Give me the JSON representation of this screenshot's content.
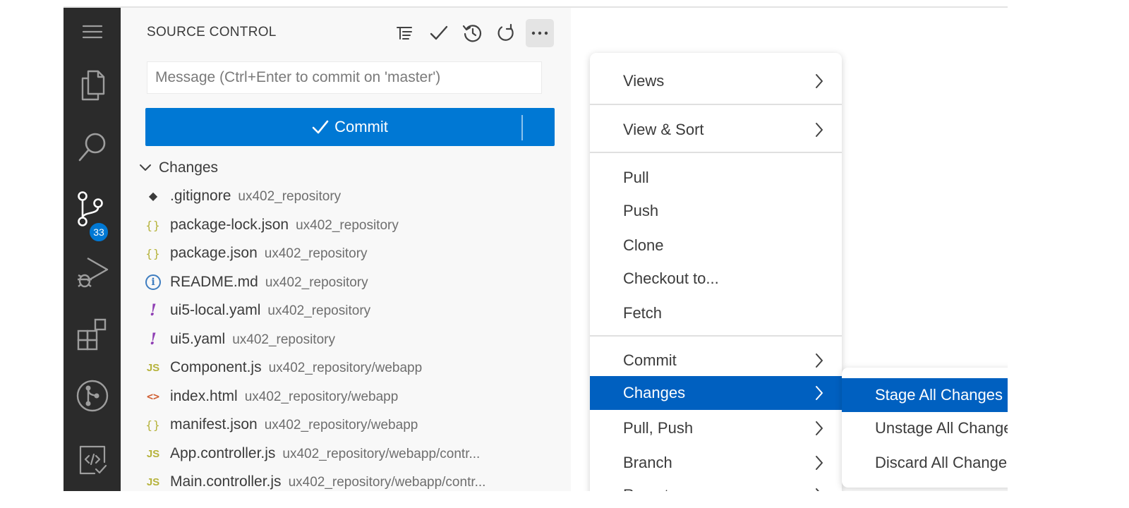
{
  "activity_bar": {
    "items": [
      {
        "name": "menu",
        "icon": "hamburger-menu-icon"
      },
      {
        "name": "explorer",
        "icon": "files-icon"
      },
      {
        "name": "search",
        "icon": "search-icon"
      },
      {
        "name": "source-control",
        "icon": "source-control-icon",
        "badge": "33"
      },
      {
        "name": "run-debug",
        "icon": "run-debug-icon"
      },
      {
        "name": "extensions",
        "icon": "extensions-icon"
      },
      {
        "name": "git-graph",
        "icon": "git-graph-icon"
      },
      {
        "name": "sap-tools",
        "icon": "code-check-icon"
      }
    ]
  },
  "sidebar": {
    "title": "SOURCE CONTROL",
    "toolbar": [
      "tree-view-icon",
      "check-icon",
      "history-icon",
      "refresh-icon",
      "more-actions-icon"
    ],
    "commit_placeholder": "Message (Ctrl+Enter to commit on 'master')",
    "commit_label": "Commit",
    "changes_label": "Changes",
    "files": [
      {
        "icon": "git-icon",
        "glyph": "◆",
        "name": ".gitignore",
        "path": "ux402_repository"
      },
      {
        "icon": "json-icon",
        "glyph": "{}",
        "name": "package-lock.json",
        "path": "ux402_repository"
      },
      {
        "icon": "json-icon",
        "glyph": "{}",
        "name": "package.json",
        "path": "ux402_repository"
      },
      {
        "icon": "info-icon",
        "glyph": "i",
        "name": "README.md",
        "path": "ux402_repository"
      },
      {
        "icon": "yaml-icon",
        "glyph": "!",
        "name": "ui5-local.yaml",
        "path": "ux402_repository"
      },
      {
        "icon": "yaml-icon",
        "glyph": "!",
        "name": "ui5.yaml",
        "path": "ux402_repository"
      },
      {
        "icon": "js-icon",
        "glyph": "JS",
        "name": "Component.js",
        "path": "ux402_repository/webapp"
      },
      {
        "icon": "html-icon",
        "glyph": "<>",
        "name": "index.html",
        "path": "ux402_repository/webapp"
      },
      {
        "icon": "json-icon",
        "glyph": "{}",
        "name": "manifest.json",
        "path": "ux402_repository/webapp"
      },
      {
        "icon": "js-icon",
        "glyph": "JS",
        "name": "App.controller.js",
        "path": "ux402_repository/webapp/contr..."
      },
      {
        "icon": "js-icon",
        "glyph": "JS",
        "name": "Main.controller.js",
        "path": "ux402_repository/webapp/contr..."
      }
    ]
  },
  "menu": {
    "items": [
      {
        "label": "Views",
        "submenu": true
      },
      {
        "label": "View & Sort",
        "submenu": true
      },
      {
        "label": "Pull",
        "submenu": false
      },
      {
        "label": "Push",
        "submenu": false
      },
      {
        "label": "Clone",
        "submenu": false
      },
      {
        "label": "Checkout to...",
        "submenu": false
      },
      {
        "label": "Fetch",
        "submenu": false
      },
      {
        "label": "Commit",
        "submenu": true
      },
      {
        "label": "Changes",
        "submenu": true,
        "active": true
      },
      {
        "label": "Pull, Push",
        "submenu": true
      },
      {
        "label": "Branch",
        "submenu": true
      },
      {
        "label": "Remote",
        "submenu": true
      }
    ]
  },
  "submenu": {
    "items": [
      {
        "label": "Stage All Changes",
        "active": true
      },
      {
        "label": "Unstage All Changes"
      },
      {
        "label": "Discard All Changes"
      }
    ]
  },
  "colors": {
    "activity_bar": "#2b2b2b",
    "accent": "#0078d4",
    "menu_highlight": "#0060c0"
  }
}
